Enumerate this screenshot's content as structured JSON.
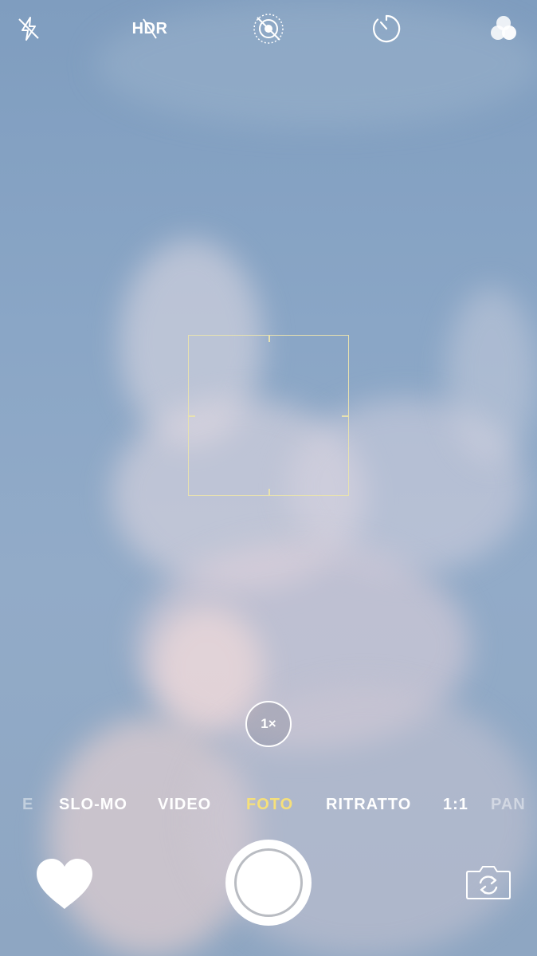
{
  "top_bar": {
    "flash_icon": "flash-off-icon",
    "hdr_label": "HDR",
    "live_photo_icon": "live-photo-off-icon",
    "timer_icon": "timer-icon",
    "filters_icon": "filters-icon"
  },
  "zoom": {
    "label": "1×"
  },
  "modes": {
    "items": [
      {
        "label": "E"
      },
      {
        "label": "SLO-MO"
      },
      {
        "label": "VIDEO"
      },
      {
        "label": "FOTO"
      },
      {
        "label": "RITRATTO"
      },
      {
        "label": "1:1"
      },
      {
        "label": "PAN"
      }
    ],
    "selected": "FOTO"
  },
  "bottom_bar": {
    "thumbnail_icon": "heart-icon",
    "shutter_icon": "shutter-button",
    "switch_camera_icon": "switch-camera-icon"
  },
  "colors": {
    "active_mode": "#f6e07a",
    "focus_box": "#e8e2b0",
    "sky": "#8aa6c6"
  }
}
